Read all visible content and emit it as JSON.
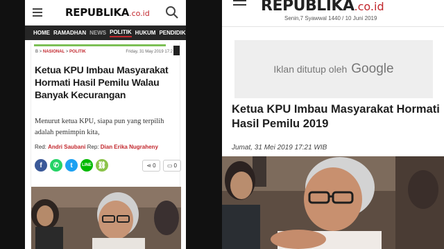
{
  "left": {
    "logo": "REPUBLIKA",
    "logo_tld": ".co.id",
    "nav": [
      "HOME",
      "RAMADHAN",
      "NEWS",
      "POLITIK",
      "HUKUM",
      "PENDIDIK"
    ],
    "breadcrumb": {
      "home": "B",
      "section": "NASIONAL",
      "sub": "POLITIK"
    },
    "date": "Friday, 31 May 2019 17:2",
    "title": "Ketua KPU Imbau Masyarakat Hormati Hasil Pemilu Walau Banyak Kecurangan",
    "lead": "Menurut ketua KPU, siapa pun yang terpilih adalah pemimpin kita,",
    "credit": {
      "red_label": "Red:",
      "red_name": "Andri Saubani",
      "rep_label": "Rep:",
      "rep_name": "Dian Erika Nugraheny"
    },
    "share_count": "0",
    "comment_count": "0"
  },
  "right": {
    "logo": "REPUBLIKA",
    "logo_tld": ".co.id",
    "date": "Senin,7 Syawwal 1440 / 10 Juni 2019",
    "ad_text": "Iklan ditutup oleh",
    "ad_brand": "Google",
    "title": "Ketua KPU Imbau Masyarakat Hormati Hasil Pemilu 2019",
    "time": "Jumat, 31 Mei 2019 17:21 WIB"
  },
  "colors": {
    "brand_red": "#c2272d",
    "nav_bg": "#262626",
    "progress_green": "#7cbf55"
  }
}
